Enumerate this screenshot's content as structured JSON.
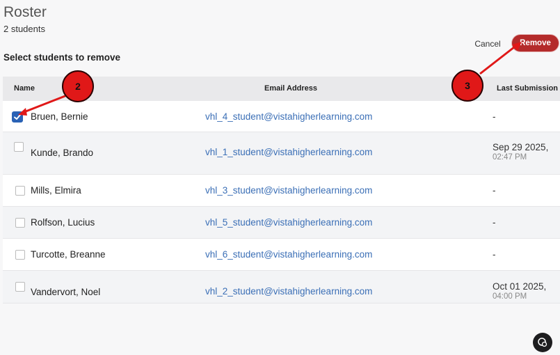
{
  "header": {
    "title": "Roster",
    "subtitle": "2 students",
    "instruction": "Select students to remove"
  },
  "actions": {
    "cancel_label": "Cancel",
    "remove_label": "Remove"
  },
  "table": {
    "columns": {
      "name": "Name",
      "email": "Email Address",
      "last": "Last Submission"
    },
    "rows": [
      {
        "name": "Bruen, Bernie",
        "email": "vhl_4_student@vistahigherlearning.com",
        "last": "-",
        "last_time": "",
        "checked": true
      },
      {
        "name": "Kunde, Brando",
        "email": "vhl_1_student@vistahigherlearning.com",
        "last": "Sep 29 2025,",
        "last_time": "02:47 PM",
        "checked": false
      },
      {
        "name": "Mills, Elmira",
        "email": "vhl_3_student@vistahigherlearning.com",
        "last": "-",
        "last_time": "",
        "checked": false
      },
      {
        "name": "Rolfson, Lucius",
        "email": "vhl_5_student@vistahigherlearning.com",
        "last": "-",
        "last_time": "",
        "checked": false
      },
      {
        "name": "Turcotte, Breanne",
        "email": "vhl_6_student@vistahigherlearning.com",
        "last": "-",
        "last_time": "",
        "checked": false
      },
      {
        "name": "Vandervort, Noel",
        "email": "vhl_2_student@vistahigherlearning.com",
        "last": "Oct 01 2025,",
        "last_time": "04:00 PM",
        "checked": false
      }
    ]
  },
  "callouts": [
    "2",
    "3"
  ],
  "colors": {
    "accent": "#2a62b5",
    "danger": "#b42b2b",
    "callout": "#e01818",
    "link": "#3b6fb6"
  },
  "icons": {
    "chat": "chat-bubble-icon",
    "check": "checkmark-icon"
  }
}
